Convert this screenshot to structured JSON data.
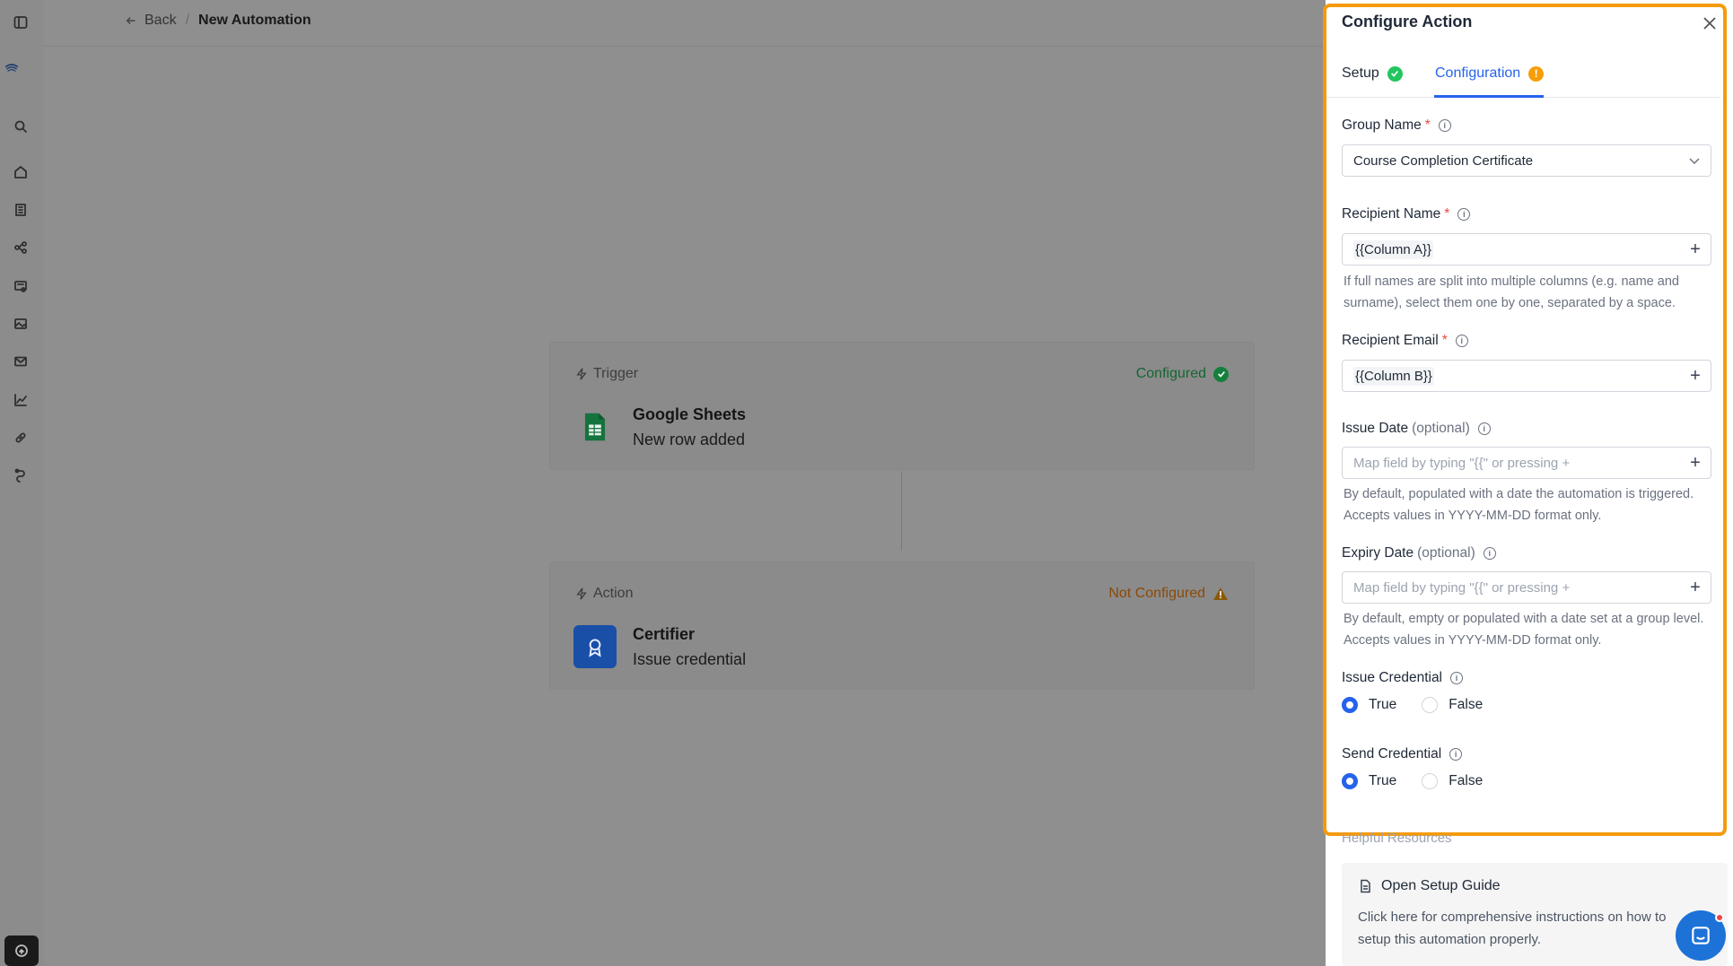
{
  "topbar": {
    "back_label": "Back",
    "separator": "/",
    "current_page": "New Automation"
  },
  "rail": {
    "icons": [
      "sidebar-toggle-icon",
      "logo-icon",
      "search-icon",
      "home-icon",
      "building-icon",
      "workflow-icon",
      "certificate-icon",
      "image-icon",
      "mail-icon",
      "chart-icon",
      "link-icon",
      "integrations-icon",
      "help-icon"
    ]
  },
  "trigger": {
    "type": "Trigger",
    "status": "Configured",
    "status_color": "#16a34a",
    "app": "Google Sheets",
    "event": "New row added"
  },
  "action": {
    "type": "Action",
    "status": "Not Configured",
    "status_color": "#b45309",
    "app": "Certifier",
    "event": "Issue credential"
  },
  "panel": {
    "title": "Configure Action",
    "tabs": [
      {
        "label": "Setup",
        "state": "complete"
      },
      {
        "label": "Configuration",
        "state": "warning",
        "badge": "!"
      }
    ],
    "fields": {
      "group_name": {
        "label": "Group Name",
        "required": "*",
        "value": "Course Completion Certificate"
      },
      "recipient_name": {
        "label": "Recipient Name",
        "required": "*",
        "value": "{{Column A}}",
        "plus": "+",
        "hint": "If full names are split into multiple columns (e.g. name and surname), select them one by one, separated by a space."
      },
      "recipient_email": {
        "label": "Recipient Email",
        "required": "*",
        "value": "{{Column B}}",
        "plus": "+"
      },
      "issue_date": {
        "label": "Issue Date",
        "optional": "(optional)",
        "placeholder": "Map field by typing \"{{\" or pressing +",
        "plus": "+",
        "hint": "By default, populated with a date the automation is triggered. Accepts values in YYYY-MM-DD format only."
      },
      "expiry_date": {
        "label": "Expiry Date",
        "optional": "(optional)",
        "placeholder": "Map field by typing \"{{\" or pressing +",
        "plus": "+",
        "hint": "By default, empty or populated with a date set at a group level. Accepts values in YYYY-MM-DD format only."
      },
      "issue_credential": {
        "label": "Issue Credential",
        "options": [
          "True",
          "False"
        ],
        "selected": "True"
      },
      "send_credential": {
        "label": "Send Credential",
        "options": [
          "True",
          "False"
        ],
        "selected": "True"
      }
    },
    "resources": {
      "title": "Helpful Resources",
      "item_title": "Open Setup Guide",
      "item_desc": "Click here for comprehensive instructions on how to setup this automation properly."
    },
    "highlight_color": "#f59a0b",
    "accent": "#2563eb"
  }
}
